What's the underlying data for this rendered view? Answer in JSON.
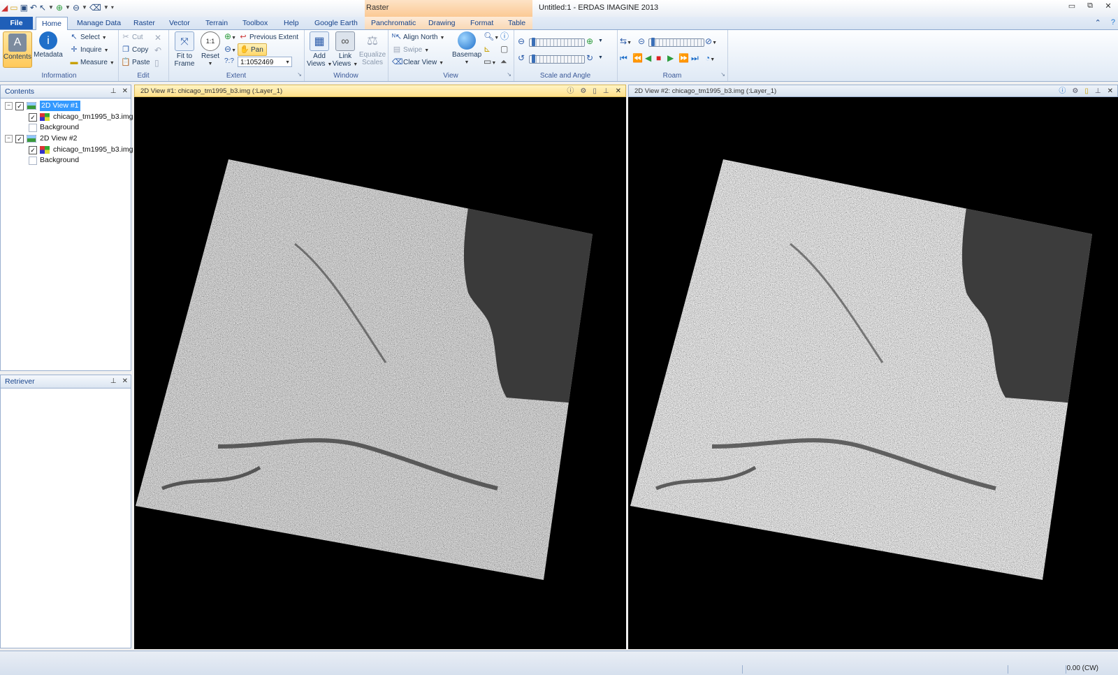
{
  "app": {
    "title": "Untitled:1 - ERDAS IMAGINE 2013",
    "context_tab_group": "Raster",
    "window_buttons": [
      "▭",
      "⧉",
      "✕"
    ]
  },
  "tabs": {
    "file": "File",
    "home": "Home",
    "manage_data": "Manage Data",
    "raster": "Raster",
    "vector": "Vector",
    "terrain": "Terrain",
    "toolbox": "Toolbox",
    "help": "Help",
    "google_earth": "Google Earth",
    "panchromatic": "Panchromatic",
    "drawing": "Drawing",
    "format": "Format",
    "table": "Table"
  },
  "ribbon": {
    "information": {
      "label": "Information",
      "contents": "Contents",
      "metadata": "Metadata",
      "select": "Select",
      "inquire": "Inquire",
      "measure": "Measure"
    },
    "edit": {
      "label": "Edit",
      "cut": "Cut",
      "copy": "Copy",
      "paste": "Paste"
    },
    "extent": {
      "label": "Extent",
      "fit_to_frame_1": "Fit to",
      "fit_to_frame_2": "Frame",
      "reset": "Reset",
      "previous_extent": "Previous Extent",
      "pan": "Pan",
      "scale_value": "1:1052469"
    },
    "window": {
      "label": "Window",
      "add_views_1": "Add",
      "add_views_2": "Views",
      "link_views_1": "Link",
      "link_views_2": "Views",
      "equalize_scales_1": "Equalize",
      "equalize_scales_2": "Scales"
    },
    "view": {
      "label": "View",
      "align_north": "Align North",
      "swipe": "Swipe",
      "clear_view": "Clear View",
      "basemap": "Basemap"
    },
    "scale_and_angle": {
      "label": "Scale and Angle"
    },
    "roam": {
      "label": "Roam"
    }
  },
  "contents_panel": {
    "title": "Contents",
    "items": [
      {
        "label": "2D View #1",
        "type": "view",
        "selected": true,
        "expanded": true
      },
      {
        "label": "chicago_tm1995_b3.img",
        "type": "raster-layer",
        "checked": true
      },
      {
        "label": "Background",
        "type": "background"
      },
      {
        "label": "2D View #2",
        "type": "view",
        "selected": false,
        "expanded": true
      },
      {
        "label": "chicago_tm1995_b3.img",
        "type": "raster-layer",
        "checked": true
      },
      {
        "label": "Background",
        "type": "background"
      }
    ]
  },
  "retriever_panel": {
    "title": "Retriever"
  },
  "views": [
    {
      "title": "2D View #1: chicago_tm1995_b3.img (:Layer_1)",
      "active": true
    },
    {
      "title": "2D View #2: chicago_tm1995_b3.img (:Layer_1)",
      "active": false
    }
  ],
  "status_bar": {
    "rotation": "0.00 (CW)"
  },
  "colors": {
    "accent": "#1f5fb8",
    "active_view_header": "#ffe89a",
    "inactive_view_header": "#dfe8f3",
    "selection": "#3399ff",
    "canvas": "#000000"
  }
}
